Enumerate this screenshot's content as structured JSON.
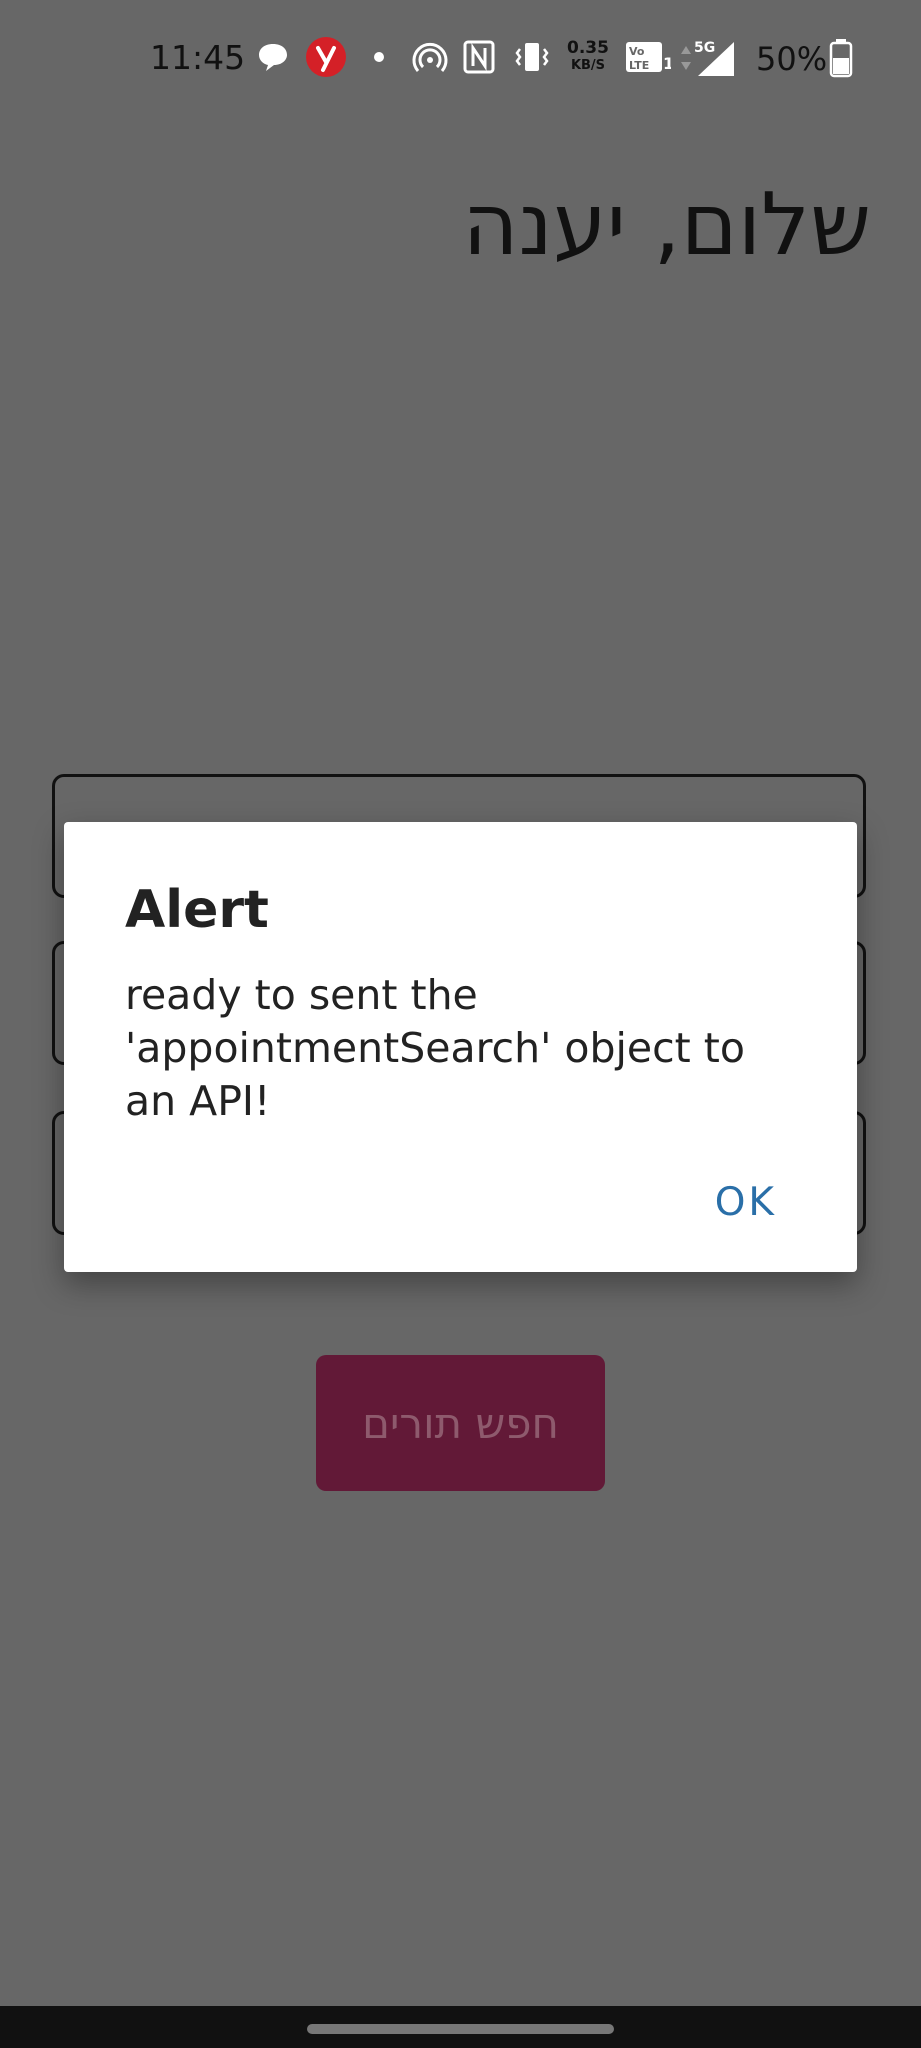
{
  "status_bar": {
    "time": "11:45",
    "net_speed_value": "0.35",
    "net_speed_unit": "KB/S",
    "network": "5G",
    "battery_percent": "50%",
    "icons": [
      "chat-bubble-icon",
      "ynet-app-icon",
      "dot-icon",
      "hotspot-icon",
      "nfc-icon",
      "vibrate-icon",
      "volte-icon",
      "data-arrows-icon",
      "signal-icon",
      "battery-icon"
    ]
  },
  "app": {
    "greeting": "שלום, יענה",
    "search_button_label": "חפש תורים"
  },
  "dialog": {
    "title": "Alert",
    "message": "ready to sent the 'appointmentSearch' object to an API!",
    "ok_label": "OK"
  },
  "colors": {
    "scrim": "#676767",
    "button_bg": "#621937",
    "dialog_accent": "#2a6fa8"
  }
}
